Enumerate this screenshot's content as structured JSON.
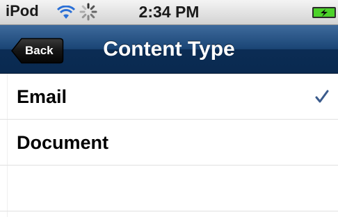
{
  "status_bar": {
    "carrier": "iPod",
    "time": "2:34 PM",
    "icons": [
      "wifi-icon",
      "activity-spinner-icon",
      "battery-charging-icon"
    ]
  },
  "nav": {
    "back_label": "Back",
    "title": "Content Type"
  },
  "list": {
    "items": [
      {
        "label": "Email",
        "selected": true
      },
      {
        "label": "Document",
        "selected": false
      },
      {
        "label": "",
        "selected": false
      }
    ],
    "check_icon": "checkmark-icon",
    "check_color": "#3b5b8c"
  },
  "colors": {
    "nav_bar": "#1a4575",
    "status_bar": "#dcdcdc",
    "battery_fill": "#4cd22a"
  }
}
